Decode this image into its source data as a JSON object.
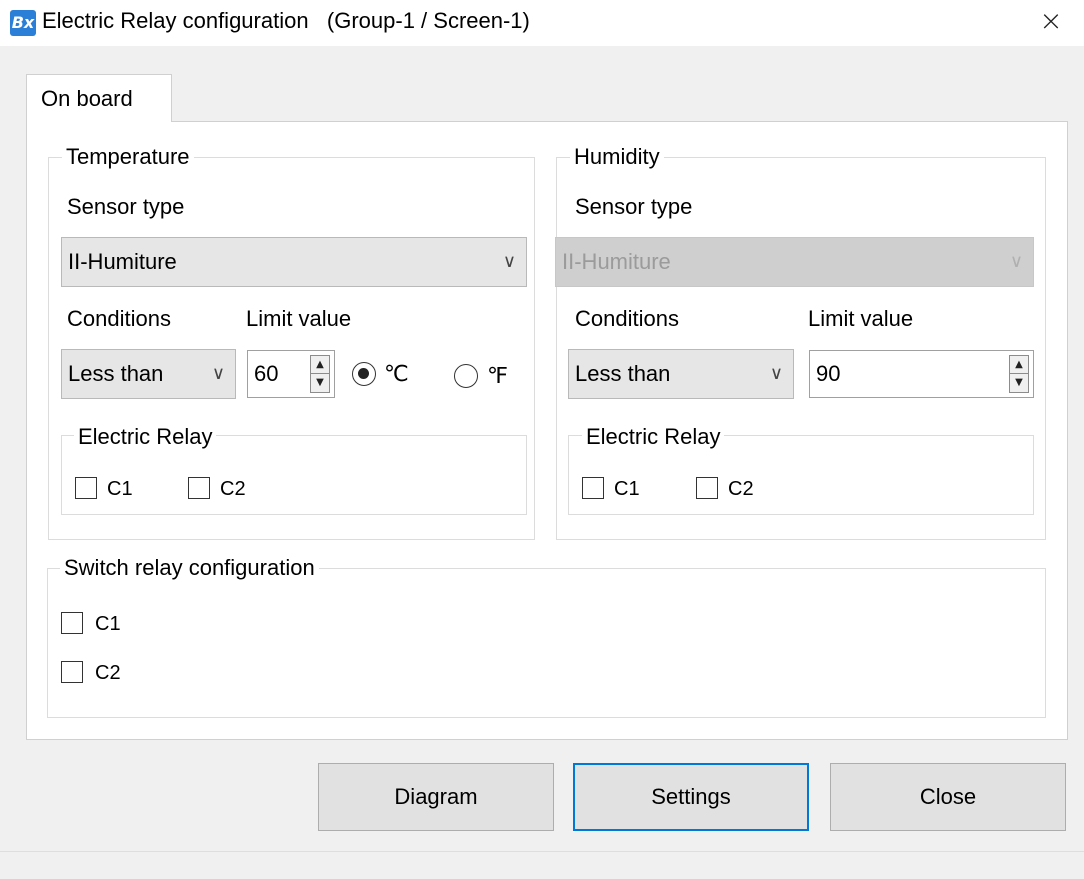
{
  "window": {
    "icon_text": "Bx",
    "title": "Electric Relay configuration   (Group-1 / Screen-1)",
    "close_glyph": "×"
  },
  "tabs": [
    {
      "label": "On board",
      "selected": true
    }
  ],
  "temperature": {
    "group_label": "Temperature",
    "sensor_type_label": "Sensor type",
    "sensor_type_value": "II-Humiture",
    "conditions_label": "Conditions",
    "conditions_value": "Less than",
    "limit_label": "Limit value",
    "limit_value": "60",
    "units": [
      {
        "label": "℃",
        "selected": true
      },
      {
        "label": "℉",
        "selected": false
      }
    ],
    "relay": {
      "group_label": "Electric Relay",
      "options": [
        {
          "label": "C1",
          "checked": false
        },
        {
          "label": "C2",
          "checked": false
        }
      ]
    }
  },
  "humidity": {
    "group_label": "Humidity",
    "sensor_type_label": "Sensor type",
    "sensor_type_value": "II-Humiture",
    "sensor_type_disabled": true,
    "conditions_label": "Conditions",
    "conditions_value": "Less than",
    "limit_label": "Limit value",
    "limit_value": "90",
    "relay": {
      "group_label": "Electric Relay",
      "options": [
        {
          "label": "C1",
          "checked": false
        },
        {
          "label": "C2",
          "checked": false
        }
      ]
    }
  },
  "switch_relay": {
    "group_label": "Switch relay configuration",
    "options": [
      {
        "label": "C1",
        "checked": false
      },
      {
        "label": "C2",
        "checked": false
      }
    ]
  },
  "buttons": {
    "diagram": "Diagram",
    "settings": "Settings",
    "close": "Close"
  },
  "glyphs": {
    "chevron_down": "∨",
    "spin_up": "▲",
    "spin_down": "▼"
  },
  "colors": {
    "accent": "#0078d7",
    "app_icon": "#2b7fd6",
    "disabled_field": "#cfcfcf"
  }
}
